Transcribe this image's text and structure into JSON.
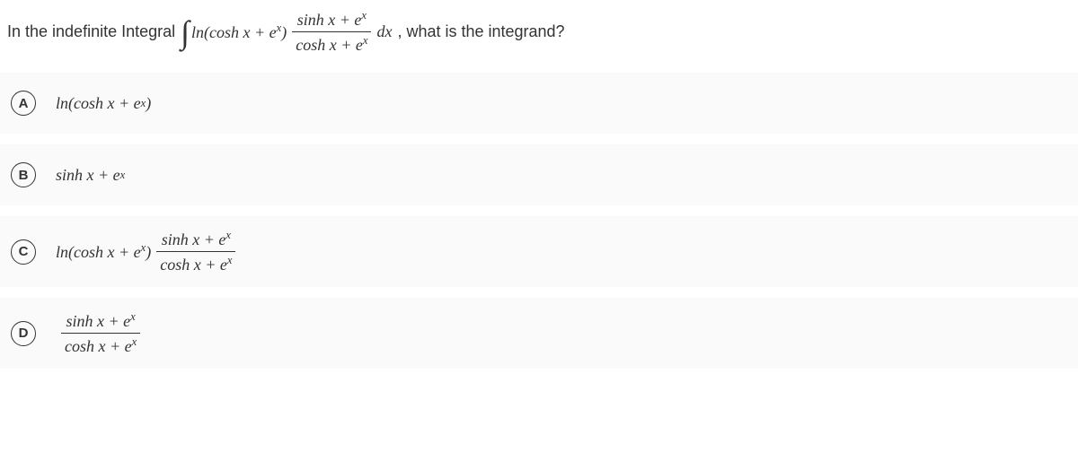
{
  "question": {
    "text_before": "In the indefinite Integral",
    "integral_body": "ln(cosh x + e",
    "integral_body_end": ")",
    "frac_num_a": "sinh x + e",
    "frac_den_a": "cosh x + e",
    "dx": "dx",
    "text_after": ", what is the integrand?",
    "sup_x": "x"
  },
  "options": [
    {
      "letter": "A",
      "type": "simple",
      "text_pre": "ln(cosh x + e",
      "text_post": ")"
    },
    {
      "letter": "B",
      "type": "simple",
      "text_pre": "sinh x + e",
      "text_post": ""
    },
    {
      "letter": "C",
      "type": "frac_with_prefix",
      "prefix_pre": "ln(cosh x + e",
      "prefix_post": ")",
      "num_pre": "sinh x + e",
      "den_pre": "cosh x + e"
    },
    {
      "letter": "D",
      "type": "frac_only",
      "num_pre": "sinh x + e",
      "den_pre": "cosh x + e"
    }
  ]
}
